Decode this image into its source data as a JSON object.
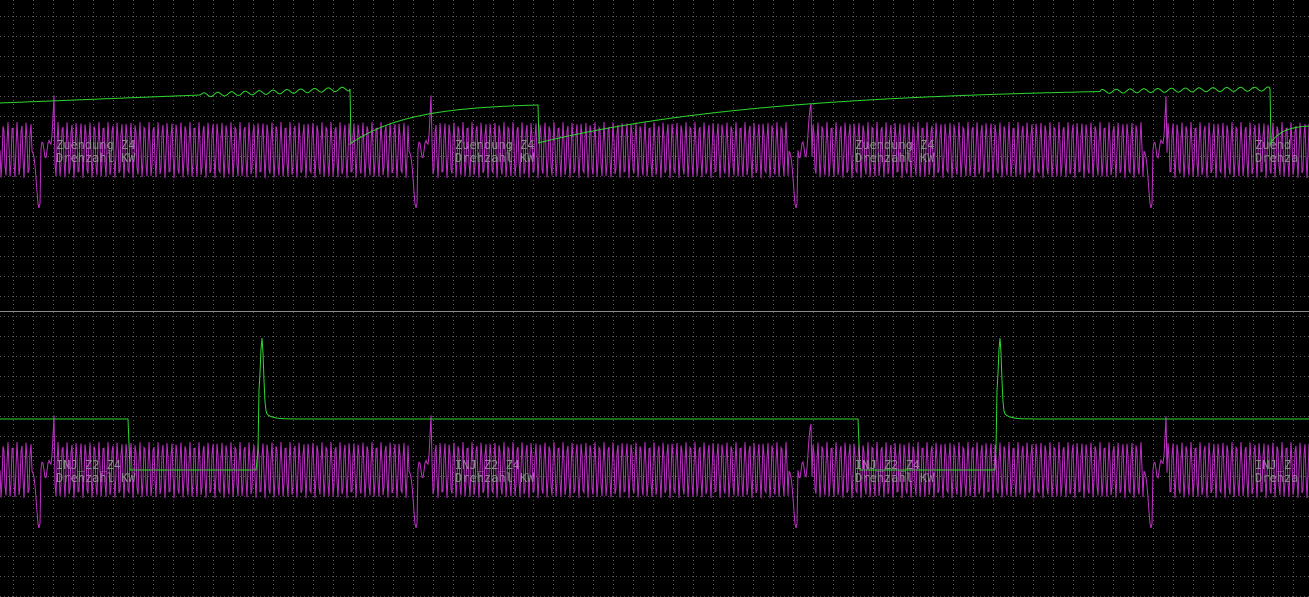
{
  "colors": {
    "background": "#000000",
    "grid": "#5a5a5a",
    "divider": "#8a8a8a",
    "label": "#8c8c8c",
    "crank_signal": "#c030c8",
    "channel_signal": "#2ed82e"
  },
  "chart_data": [
    {
      "type": "line",
      "panel": "top",
      "grid": true,
      "series": [
        {
          "name": "Zuendung Z4",
          "kind": "ignition"
        },
        {
          "name": "Drehzahl KW",
          "kind": "crank"
        }
      ],
      "labels": [
        {
          "signal": "Zuendung Z4",
          "crank": "Drehzahl KW"
        },
        {
          "signal": "Zuendung Z4",
          "crank": "Drehzahl KW"
        },
        {
          "signal": "Zuendung Z4",
          "crank": "Drehzahl KW"
        },
        {
          "signal": "Zuend",
          "crank": "Drehza"
        }
      ]
    },
    {
      "type": "line",
      "panel": "bottom",
      "grid": true,
      "series": [
        {
          "name": "INJ_Z2_Z4",
          "kind": "injection"
        },
        {
          "name": "Drehzahl KW",
          "kind": "crank"
        }
      ],
      "labels": [
        {
          "signal": "INJ_Z2_Z4",
          "crank": "Drehzahl KW"
        },
        {
          "signal": "INJ_Z2_Z4",
          "crank": "Drehzahl KW"
        },
        {
          "signal": "INJ_Z2_Z4",
          "crank": "Drehzahl KW"
        },
        {
          "signal": "INJ_Z",
          "crank": "Drehza"
        }
      ]
    }
  ]
}
